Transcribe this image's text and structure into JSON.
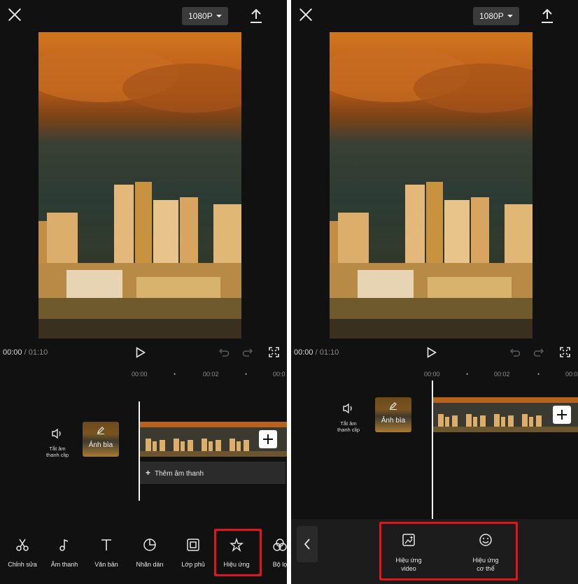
{
  "top": {
    "resolution": "1080P"
  },
  "player": {
    "current_time": "00:00",
    "separator": " / ",
    "total_time": "01:10"
  },
  "timeline": {
    "ruler_left": [
      "00:00",
      "•",
      "00:02",
      "•",
      "00:0"
    ],
    "ruler_right": [
      "00:00",
      "•",
      "00:02",
      "•",
      "00:0"
    ],
    "mute_label_1": "Tắt âm",
    "mute_label_2": "thanh clip",
    "cover_label": "Ảnh bìa",
    "add_audio_label": "Thêm âm thanh",
    "add_audio_plus": "+"
  },
  "toolbar": {
    "items": [
      {
        "label": "Chỉnh sửa",
        "icon": "scissors-icon"
      },
      {
        "label": "Âm thanh",
        "icon": "music-note-icon"
      },
      {
        "label": "Văn bản",
        "icon": "text-icon"
      },
      {
        "label": "Nhãn dán",
        "icon": "sticker-icon"
      },
      {
        "label": "Lớp phủ",
        "icon": "overlay-icon"
      },
      {
        "label": "Hiệu ứng",
        "icon": "effects-star-icon"
      },
      {
        "label": "Bộ lọ",
        "icon": "filter-icon"
      }
    ]
  },
  "effects_menu": {
    "video_effect_1": "Hiệu ứng",
    "video_effect_2": "video",
    "body_effect_1": "Hiệu ứng",
    "body_effect_2": "cơ thể"
  },
  "colors": {
    "highlight": "#e2141c",
    "background": "#111111",
    "button": "#3a3a3a"
  }
}
